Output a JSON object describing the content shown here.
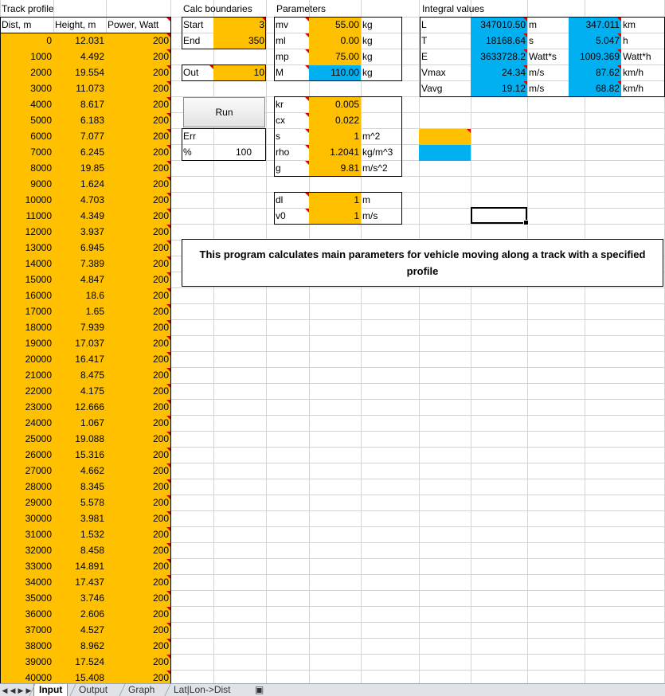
{
  "track_profile": {
    "title": "Track profile",
    "headers": [
      "Dist, m",
      "Height, m",
      "Power, Watt"
    ],
    "rows": [
      [
        "0",
        "12.031",
        "200"
      ],
      [
        "1000",
        "4.492",
        "200"
      ],
      [
        "2000",
        "19.554",
        "200"
      ],
      [
        "3000",
        "11.073",
        "200"
      ],
      [
        "4000",
        "8.617",
        "200"
      ],
      [
        "5000",
        "6.183",
        "200"
      ],
      [
        "6000",
        "7.077",
        "200"
      ],
      [
        "7000",
        "6.245",
        "200"
      ],
      [
        "8000",
        "19.85",
        "200"
      ],
      [
        "9000",
        "1.624",
        "200"
      ],
      [
        "10000",
        "4.703",
        "200"
      ],
      [
        "11000",
        "4.349",
        "200"
      ],
      [
        "12000",
        "3.937",
        "200"
      ],
      [
        "13000",
        "6.945",
        "200"
      ],
      [
        "14000",
        "7.389",
        "200"
      ],
      [
        "15000",
        "4.847",
        "200"
      ],
      [
        "16000",
        "18.6",
        "200"
      ],
      [
        "17000",
        "1.65",
        "200"
      ],
      [
        "18000",
        "7.939",
        "200"
      ],
      [
        "19000",
        "17.037",
        "200"
      ],
      [
        "20000",
        "16.417",
        "200"
      ],
      [
        "21000",
        "8.475",
        "200"
      ],
      [
        "22000",
        "4.175",
        "200"
      ],
      [
        "23000",
        "12.666",
        "200"
      ],
      [
        "24000",
        "1.067",
        "200"
      ],
      [
        "25000",
        "19.088",
        "200"
      ],
      [
        "26000",
        "15.316",
        "200"
      ],
      [
        "27000",
        "4.662",
        "200"
      ],
      [
        "28000",
        "8.345",
        "200"
      ],
      [
        "29000",
        "5.578",
        "200"
      ],
      [
        "30000",
        "3.981",
        "200"
      ],
      [
        "31000",
        "1.532",
        "200"
      ],
      [
        "32000",
        "8.458",
        "200"
      ],
      [
        "33000",
        "14.891",
        "200"
      ],
      [
        "34000",
        "17.437",
        "200"
      ],
      [
        "35000",
        "3.746",
        "200"
      ],
      [
        "36000",
        "2.606",
        "200"
      ],
      [
        "37000",
        "4.527",
        "200"
      ],
      [
        "38000",
        "8.962",
        "200"
      ],
      [
        "39000",
        "17.524",
        "200"
      ],
      [
        "40000",
        "15.408",
        "200"
      ]
    ]
  },
  "calc_boundaries": {
    "title": "Calc boundaries",
    "start_label": "Start",
    "start_value": "3",
    "end_label": "End",
    "end_value": "350",
    "out_label": "Out",
    "out_value": "10",
    "run_label": "Run",
    "err_label": "Err",
    "pct_label": "%",
    "pct_value": "100"
  },
  "parameters": {
    "title": "Parameters",
    "mass": [
      {
        "name": "mv",
        "value": "55.00",
        "unit": "kg"
      },
      {
        "name": "ml",
        "value": "0.00",
        "unit": "kg"
      },
      {
        "name": "mp",
        "value": "75.00",
        "unit": "kg"
      },
      {
        "name": "M",
        "value": "110.00",
        "unit": "kg"
      }
    ],
    "physics": [
      {
        "name": "kr",
        "value": "0.005",
        "unit": ""
      },
      {
        "name": "cx",
        "value": "0.022",
        "unit": ""
      },
      {
        "name": "s",
        "value": "1",
        "unit": "m^2"
      },
      {
        "name": "rho",
        "value": "1.2041",
        "unit": "kg/m^3"
      },
      {
        "name": "g",
        "value": "9.81",
        "unit": "m/s^2"
      }
    ],
    "sim": [
      {
        "name": "dl",
        "value": "1",
        "unit": "m"
      },
      {
        "name": "v0",
        "value": "1",
        "unit": "m/s"
      }
    ]
  },
  "integral_values": {
    "title": "Integral values",
    "rows": [
      {
        "name": "L",
        "v1": "347010.50",
        "u1": "m",
        "v2": "347.011",
        "u2": "km"
      },
      {
        "name": "T",
        "v1": "18168.64",
        "u1": "s",
        "v2": "5.047",
        "u2": "h"
      },
      {
        "name": "E",
        "v1": "3633728.2",
        "u1": "Watt*s",
        "v2": "1009.369",
        "u2": "Watt*h"
      },
      {
        "name": "Vmax",
        "v1": "24.34",
        "u1": "m/s",
        "v2": "87.62",
        "u2": "km/h"
      },
      {
        "name": "Vavg",
        "v1": "19.12",
        "u1": "m/s",
        "v2": "68.82",
        "u2": "km/h"
      }
    ]
  },
  "info_text": "This program calculates main parameters for vehicle moving along a track with a specified profile",
  "sheet_tabs": [
    "Input",
    "Output",
    "Graph",
    "Lat|Lon->Dist"
  ],
  "active_tab": "Input",
  "colors": {
    "input": "#ffc000",
    "computed": "#00b0f0",
    "comment_marker": "#e00000"
  }
}
